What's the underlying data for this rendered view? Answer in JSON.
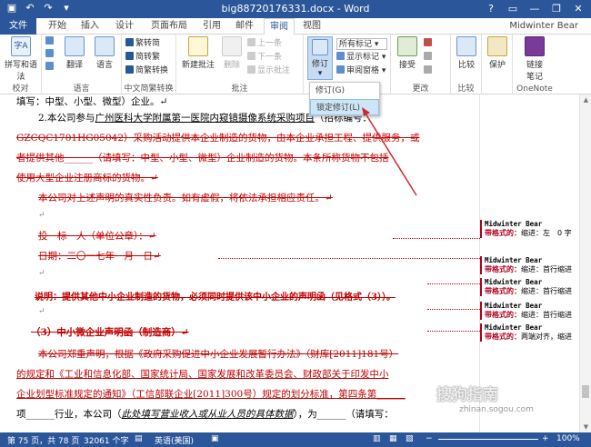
{
  "window": {
    "title": "big88720176331.docx - Word",
    "qat": [
      "save-icon",
      "undo-icon",
      "redo-icon",
      "customize-icon"
    ],
    "win_buttons": [
      "?",
      "▭",
      "—",
      "❐",
      "✕"
    ]
  },
  "tabs": [
    "文件",
    "开始",
    "插入",
    "设计",
    "页面布局",
    "引用",
    "邮件",
    "审阅",
    "视图"
  ],
  "active_tab": "审阅",
  "user": "Midwinter Bear",
  "ribbon": {
    "proofing": {
      "label": "校对",
      "spell": "拼写和语法"
    },
    "language_group": {
      "label": "语言",
      "translate": "翻译",
      "language": "语言"
    },
    "chinese_conv": {
      "label": "中文简繁转换",
      "to_trad": "繁转简",
      "to_simp": "简转繁",
      "convert": "简繁转换"
    },
    "comments": {
      "label": "批注",
      "new": "新建批注",
      "delete": "删除",
      "prev": "上一条",
      "next": "下一条",
      "show": "显示批注"
    },
    "tracking": {
      "track": "修订",
      "markup": "所有标记",
      "show_markup": "显示标记",
      "pane": "审阅窗格"
    },
    "changes": {
      "label": "更改",
      "accept": "接受"
    },
    "compare": {
      "label": "比较",
      "compare": "比较"
    },
    "protect": {
      "label": "",
      "protect": "保护"
    },
    "onenote": {
      "label": "OneNote",
      "linked": "链接\n笔记"
    }
  },
  "dropdown": {
    "items": [
      "修订(G)",
      "锁定修订(L)"
    ]
  },
  "document": {
    "lines": [
      "填写：中型、小型、微型）企业。↵",
      "2.本公司参与",
      "广州医科大学附属第一医院内窥镜摄像系统采购项目",
      "（招标编号：",
      "GZCQC1701HG05042）采购活动提供本企业制造的货物，由本企业承担工程、提供服务，或",
      "者提供其他______（请填写：中型、小型、微型）企业制造的货物。本条所称货物不包括",
      "使用大型企业注册商标的货物。↵",
      "本公司对上述声明的真实性负责。如有虚假，将依法承担相应责任。↵",
      "↵",
      "投　标　人（单位公章）：↵",
      "日期：二〇一七年　月　日↵",
      "↵",
      "说明：提供其他中小企业制造的货物，必须同时提供该中小企业的声明函（见格式（3））。",
      "↵",
      "（3）中小微企业声明函（制造商）↵",
      "本公司郑重声明，根据《政府采购促进中小企业发展暂行办法》（财库[2011]181号）",
      "的规定和《工业和信息化部、国家统计局、国家发展和改革委员会、财政部关于印发中小",
      "企业划型标准规定的通知》（工信部联企业[2011]300号）规定的划分标准，第四条第______",
      "项______行业，本公司（",
      "此处填写营业收入或从业人员的具体数据",
      "），为______（请填写："
    ]
  },
  "comments": [
    {
      "author": "Midwinter Bear",
      "label": "带格式的：",
      "text": "缩进：左　0 字"
    },
    {
      "author": "Midwinter Bear",
      "label": "带格式的：",
      "text": "缩进：首行缩进"
    },
    {
      "author": "Midwinter Bear",
      "label": "带格式的：",
      "text": "缩进：首行缩进"
    },
    {
      "author": "Midwinter Bear",
      "label": "带格式的：",
      "text": "缩进：首行缩进"
    },
    {
      "author": "Midwinter Bear",
      "label": "带格式的：",
      "text": "两端对齐，缩进"
    }
  ],
  "status": {
    "page": "第 75 页，共 78 页",
    "words": "32061 个字",
    "lang": "英语(美国)",
    "zoom": "100%"
  },
  "watermark": {
    "main": "搜狗指南",
    "sub": "zhinan.sogou.com"
  }
}
